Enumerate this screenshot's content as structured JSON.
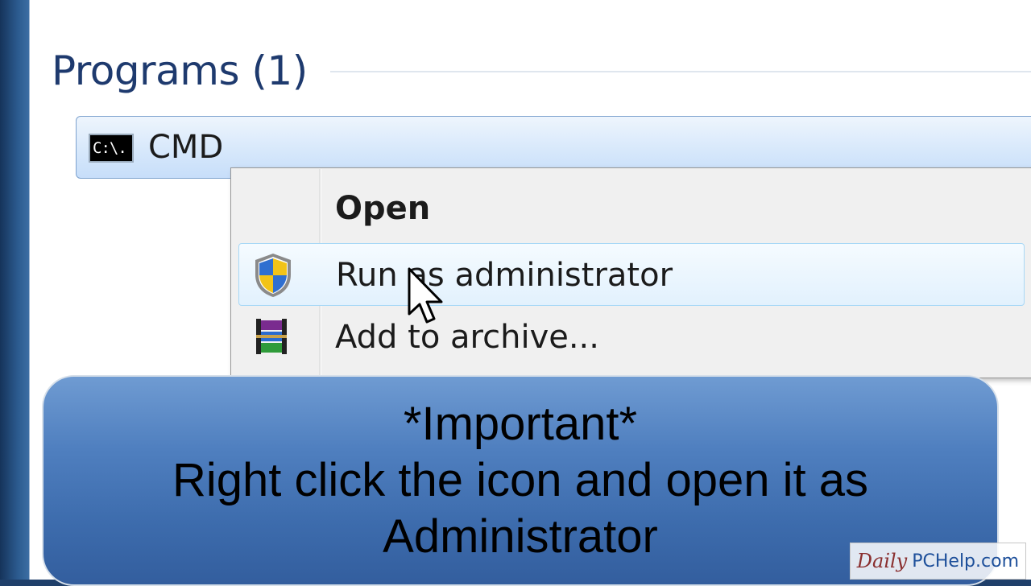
{
  "start_menu": {
    "group_header": "Programs (1)",
    "result": {
      "label": "CMD",
      "icon_text": "C:\\.",
      "icon": "command-prompt-icon"
    }
  },
  "context_menu": {
    "items": [
      {
        "label": "Open",
        "bold": true,
        "icon": ""
      },
      {
        "label": "Run as administrator",
        "bold": false,
        "icon": "uac-shield-icon",
        "hovered": true
      },
      {
        "label": "Add to archive...",
        "bold": false,
        "icon": "winrar-archive-icon"
      }
    ]
  },
  "banner": {
    "line1": "*Important*",
    "line2": "Right click the icon and open it as",
    "line3": "Administrator"
  },
  "watermark": {
    "part1": "Daily",
    "part2": "PCHelp.com"
  },
  "colors": {
    "header_text": "#1e3a6e",
    "selection_border": "#7da2ce",
    "banner_blue": "#4f7fbf",
    "hover_border": "#a8d8f6"
  }
}
